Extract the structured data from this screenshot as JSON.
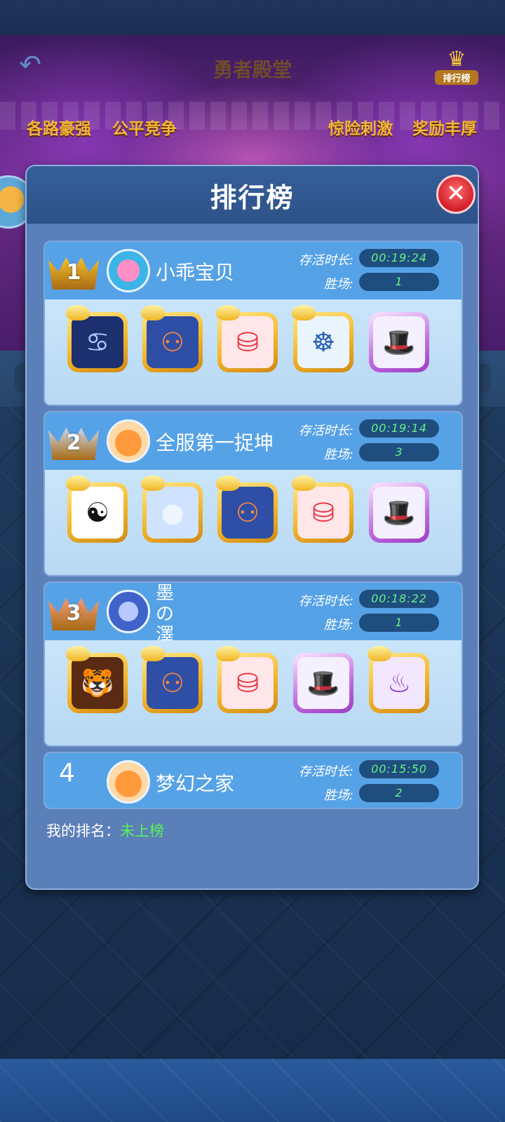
{
  "scene": {
    "title": "勇者殿堂",
    "back_icon": "back-arrow-icon",
    "ranking_entry_label": "排行榜",
    "banners": [
      "各路豪强",
      "公平竞争",
      "惊险刺激",
      "奖励丰厚"
    ]
  },
  "modal": {
    "title": "排行榜",
    "close_icon": "close-x-icon",
    "my_rank_label": "我的排名：",
    "my_rank_value": "未上榜"
  },
  "entries": [
    {
      "rank": "1",
      "medal_color": "#f5c02c",
      "avatar_icon": "pink-creature-avatar-icon",
      "name": "小乖宝贝",
      "survival_label": "存活时长:",
      "survival_value": "00:19:24",
      "wins_label": "胜场:",
      "wins_value": "1",
      "skills": [
        {
          "icon": "crab-icon",
          "glyph": "♋",
          "frame": "gold",
          "bg": "#1c2f6e",
          "fg": "#aac6ff"
        },
        {
          "icon": "body-silhouette-icon",
          "glyph": "⚇",
          "frame": "gold",
          "bg": "#2e4fa5",
          "fg": "#ff8a3a"
        },
        {
          "icon": "red-cylinder-icon",
          "glyph": "⛁",
          "frame": "gold",
          "bg": "#ffe6e8",
          "fg": "#e8333f"
        },
        {
          "icon": "meditation-icon",
          "glyph": "☸",
          "frame": "gold",
          "bg": "#eaf4ff",
          "fg": "#2a63b5"
        },
        {
          "icon": "magic-hat-icon",
          "glyph": "🎩",
          "frame": "purple",
          "bg": "#f4f0ff",
          "fg": "#3b3fb8"
        }
      ]
    },
    {
      "rank": "2",
      "medal_color": "#c9d6e6",
      "avatar_icon": "fire-spirit-avatar-icon",
      "name": "全服第一捉坤",
      "survival_label": "存活时长:",
      "survival_value": "00:19:14",
      "wins_label": "胜场:",
      "wins_value": "3",
      "skills": [
        {
          "icon": "yin-yang-icon",
          "glyph": "☯",
          "frame": "gold",
          "bg": "#ffffff",
          "fg": "#111111"
        },
        {
          "icon": "moon-icon",
          "glyph": "●",
          "frame": "gold",
          "bg": "#cfe3ff",
          "fg": "#eef5ff"
        },
        {
          "icon": "body-silhouette-icon",
          "glyph": "⚇",
          "frame": "gold",
          "bg": "#2e4fa5",
          "fg": "#ff8a3a"
        },
        {
          "icon": "red-cylinder-icon",
          "glyph": "⛁",
          "frame": "gold",
          "bg": "#ffe6e8",
          "fg": "#e8333f"
        },
        {
          "icon": "magic-hat-icon",
          "glyph": "🎩",
          "frame": "purple",
          "bg": "#f4f0ff",
          "fg": "#3b3fb8"
        }
      ]
    },
    {
      "rank": "3",
      "medal_color": "#f39a78",
      "avatar_icon": "diamond-badge-avatar-icon",
      "name": "墨の澤",
      "survival_label": "存活时长:",
      "survival_value": "00:18:22",
      "wins_label": "胜场:",
      "wins_value": "1",
      "skills": [
        {
          "icon": "tiger-icon",
          "glyph": "🐯",
          "frame": "gold",
          "bg": "#5a2b12",
          "fg": "#f6a030"
        },
        {
          "icon": "body-silhouette-icon",
          "glyph": "⚇",
          "frame": "gold",
          "bg": "#2e4fa5",
          "fg": "#ff8a3a"
        },
        {
          "icon": "red-cylinder-icon",
          "glyph": "⛁",
          "frame": "gold",
          "bg": "#ffe6e8",
          "fg": "#e8333f"
        },
        {
          "icon": "magic-hat-icon",
          "glyph": "🎩",
          "frame": "purple",
          "bg": "#f4f0ff",
          "fg": "#3b3fb8"
        },
        {
          "icon": "purple-flame-altar-icon",
          "glyph": "♨",
          "frame": "gold",
          "bg": "#f3e6ff",
          "fg": "#8a3fd0"
        }
      ]
    },
    {
      "rank": "4",
      "medal_color": "",
      "avatar_icon": "fire-spirit-avatar-icon",
      "name": "梦幻之家",
      "survival_label": "存活时长:",
      "survival_value": "00:15:50",
      "wins_label": "胜场:",
      "wins_value": "2",
      "skills": []
    }
  ]
}
